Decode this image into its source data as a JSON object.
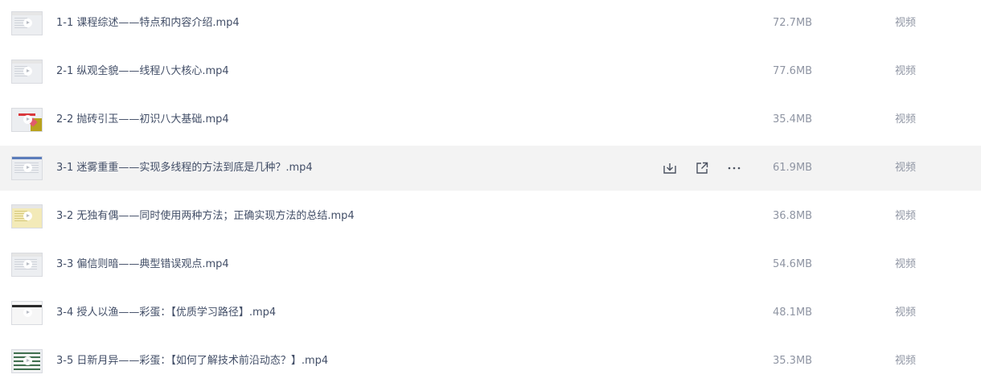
{
  "files": [
    {
      "name": "1-1 课程综述——特点和内容介绍.mp4",
      "size": "72.7MB",
      "type": "视频",
      "thumb_icon": "video-thumbnail"
    },
    {
      "name": "2-1 纵观全貌——线程八大核心.mp4",
      "size": "77.6MB",
      "type": "视频",
      "thumb_icon": "video-thumbnail"
    },
    {
      "name": "2-2 抛砖引玉——初识八大基础.mp4",
      "size": "35.4MB",
      "type": "视频",
      "thumb_icon": "video-thumbnail"
    },
    {
      "name": "3-1 迷雾重重——实现多线程的方法到底是几种？.mp4",
      "size": "61.9MB",
      "type": "视频",
      "thumb_icon": "video-thumbnail",
      "hovered": true
    },
    {
      "name": "3-2 无独有偶——同时使用两种方法；正确实现方法的总结.mp4",
      "size": "36.8MB",
      "type": "视频",
      "thumb_icon": "video-thumbnail"
    },
    {
      "name": "3-3 偏信则暗——典型错误观点.mp4",
      "size": "54.6MB",
      "type": "视频",
      "thumb_icon": "video-thumbnail"
    },
    {
      "name": "3-4 授人以渔——彩蛋：【优质学习路径】.mp4",
      "size": "48.1MB",
      "type": "视频",
      "thumb_icon": "video-thumbnail"
    },
    {
      "name": "3-5 日新月异——彩蛋：【如何了解技术前沿动态？】.mp4",
      "size": "35.3MB",
      "type": "视频",
      "thumb_icon": "video-thumbnail"
    }
  ],
  "row_actions": {
    "download_icon": "download-icon",
    "share_icon": "share-icon",
    "more_icon": "more-icon"
  },
  "colors": {
    "hover_bg": "#f3f3f3",
    "name_text": "#424e67",
    "meta_text": "#8f95a3"
  }
}
